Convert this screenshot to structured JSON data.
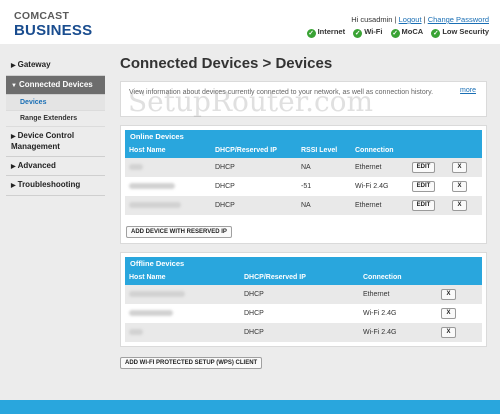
{
  "brand": {
    "line1": "COMCAST",
    "line2": "BUSINESS"
  },
  "user": {
    "greeting": "Hi cusadmin",
    "separator": "|",
    "logout": "Logout",
    "change_password": "Change Password"
  },
  "status": [
    {
      "label": "Internet",
      "color": "#3aa335"
    },
    {
      "label": "Wi-Fi",
      "color": "#3aa335"
    },
    {
      "label": "MoCA",
      "color": "#3aa335"
    },
    {
      "label": "Low Security",
      "color": "#3aa335"
    }
  ],
  "sidebar": {
    "items": [
      {
        "caret": "▶",
        "label": "Gateway"
      },
      {
        "caret": "▼",
        "label": "Connected Devices"
      },
      {
        "caret": "▶",
        "label": "Device Control Management"
      },
      {
        "caret": "▶",
        "label": "Advanced"
      },
      {
        "caret": "▶",
        "label": "Troubleshooting"
      }
    ],
    "subitems": [
      {
        "label": "Devices"
      },
      {
        "label": "Range Extenders"
      }
    ]
  },
  "page": {
    "title": "Connected Devices > Devices",
    "info": "View information about devices currently connected to your network, as well as connection history.",
    "more": "more",
    "watermark": "SetupRouter.com"
  },
  "online": {
    "title": "Online Devices",
    "headers": {
      "host": "Host Name",
      "dhcp": "DHCP/Reserved IP",
      "rssi": "RSSI Level",
      "conn": "Connection"
    },
    "rows": [
      {
        "dhcp": "DHCP",
        "rssi": "NA",
        "conn": "Ethernet"
      },
      {
        "dhcp": "DHCP",
        "rssi": "-51",
        "conn": "Wi-Fi 2.4G"
      },
      {
        "dhcp": "DHCP",
        "rssi": "NA",
        "conn": "Ethernet"
      }
    ],
    "edit_label": "EDIT",
    "remove_label": "X",
    "add_button": "ADD DEVICE WITH RESERVED IP"
  },
  "offline": {
    "title": "Offline Devices",
    "headers": {
      "host": "Host Name",
      "dhcp": "DHCP/Reserved IP",
      "conn": "Connection"
    },
    "rows": [
      {
        "dhcp": "DHCP",
        "conn": "Ethernet"
      },
      {
        "dhcp": "DHCP",
        "conn": "Wi-Fi 2.4G"
      },
      {
        "dhcp": "DHCP",
        "conn": "Wi-Fi 2.4G"
      }
    ],
    "remove_label": "X"
  },
  "wps_button": "ADD WI-FI PROTECTED SETUP (WPS) CLIENT"
}
